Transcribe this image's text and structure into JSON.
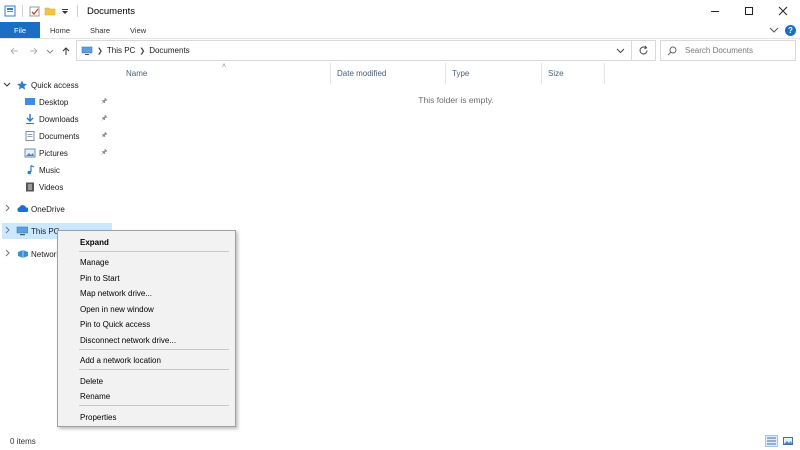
{
  "window": {
    "title": "Documents"
  },
  "ribbon": {
    "tabs": [
      "File",
      "Home",
      "Share",
      "View"
    ]
  },
  "address": {
    "crumbs": [
      "This PC",
      "Documents"
    ],
    "search_placeholder": "Search Documents"
  },
  "navpane": {
    "quick_access": "Quick access",
    "quick_items": [
      "Desktop",
      "Downloads",
      "Documents",
      "Pictures",
      "Music",
      "Videos"
    ],
    "onedrive": "OneDrive",
    "this_pc": "This PC",
    "network": "Network"
  },
  "columns": [
    "Name",
    "Date modified",
    "Type",
    "Size"
  ],
  "empty_message": "This folder is empty.",
  "status": {
    "items": "0 items"
  },
  "context_menu": {
    "items": [
      "Expand",
      "Manage",
      "Pin to Start",
      "Map network drive...",
      "Open in new window",
      "Pin to Quick access",
      "Disconnect network drive...",
      "Add a network location",
      "Delete",
      "Rename",
      "Properties"
    ]
  },
  "colors": {
    "accent": "#1a6fc4",
    "selection": "#cce8ff",
    "menu_bg": "#f2f2f2"
  }
}
